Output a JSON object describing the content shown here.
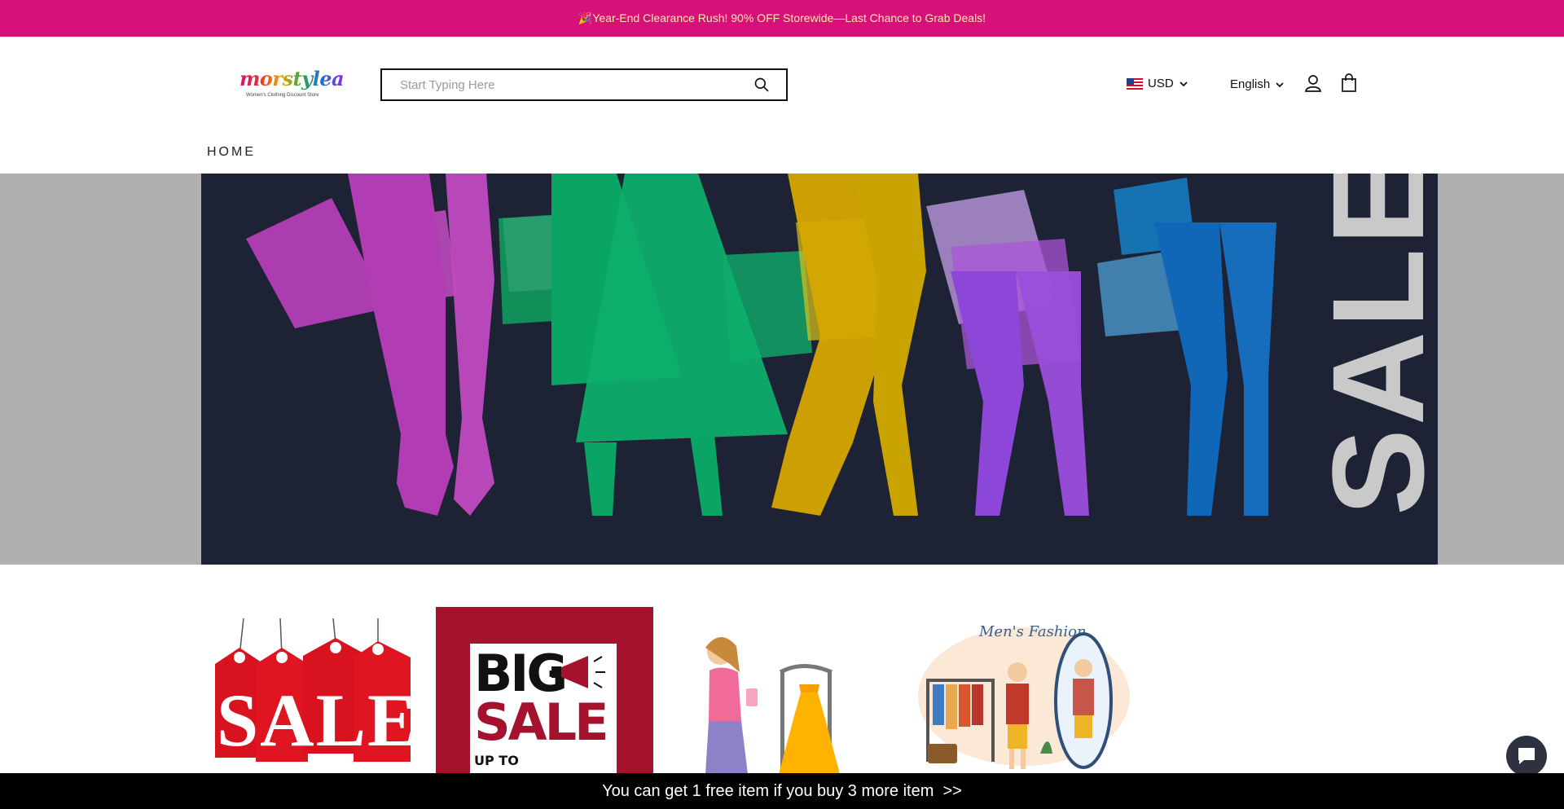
{
  "announcement": {
    "text": "🎉Year-End Clearance Rush! 90% OFF Storewide—Last Chance to Grab Deals!"
  },
  "logo": {
    "name": "morstylea",
    "tagline": "Women's Clothing Discount Store"
  },
  "search": {
    "placeholder": "Start Typing Here"
  },
  "header": {
    "currency": "USD",
    "language": "English"
  },
  "nav": {
    "home": "HOME"
  },
  "hero": {
    "text": "SALE"
  },
  "promo_cards": {
    "sale": "SALE",
    "big": "BIG",
    "big_sale": "SALE",
    "up_to": "UP TO",
    "mens_fashion": "Men's Fashion"
  },
  "bottom_bar": {
    "text": "You can get 1 free item if you buy 3 more item  >>"
  },
  "colors": {
    "announcement_bg": "#d6127a",
    "announcement_text": "#ffe9a8",
    "hero_bg": "#1e2235",
    "bottom_bar_bg": "#000000"
  }
}
